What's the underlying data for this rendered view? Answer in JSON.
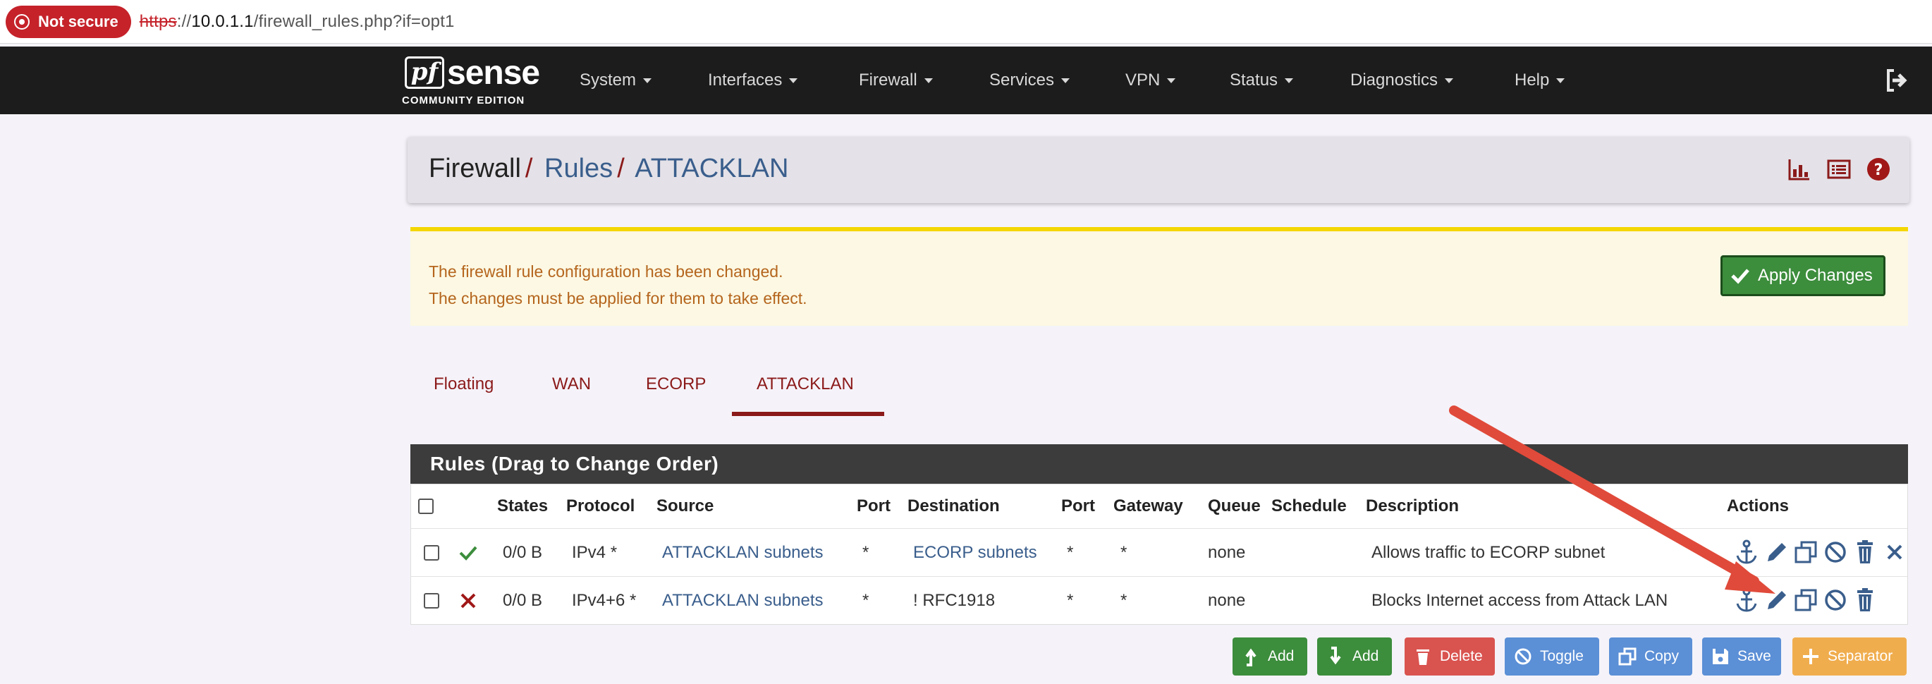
{
  "browser": {
    "security_label": "Not secure",
    "url_protocol": "https",
    "url_host": "10.0.1.1",
    "url_path": "/firewall_rules.php?if=opt1"
  },
  "brand": {
    "logo_pf": "pf",
    "logo_sense": "sense",
    "logo_subtitle": "COMMUNITY EDITION"
  },
  "nav": {
    "items": [
      "System",
      "Interfaces",
      "Firewall",
      "Services",
      "VPN",
      "Status",
      "Diagnostics",
      "Help"
    ]
  },
  "breadcrumb": {
    "root": "Firewall",
    "sep": "/",
    "level1": "Rules",
    "level2": "ATTACKLAN"
  },
  "alert": {
    "line1": "The firewall rule configuration has been changed.",
    "line2": "The changes must be applied for them to take effect.",
    "apply_label": "Apply Changes"
  },
  "tabs": {
    "items": [
      "Floating",
      "WAN",
      "ECORP",
      "ATTACKLAN"
    ],
    "active": "ATTACKLAN"
  },
  "rules": {
    "title": "Rules (Drag to Change Order)",
    "columns": [
      "States",
      "Protocol",
      "Source",
      "Port",
      "Destination",
      "Port",
      "Gateway",
      "Queue",
      "Schedule",
      "Description",
      "Actions"
    ],
    "rows": [
      {
        "status": "pass",
        "states": "0/0 B",
        "protocol": "IPv4 *",
        "source": "ATTACKLAN subnets",
        "source_port": "*",
        "destination": "ECORP subnets",
        "dest_port": "*",
        "gateway": "*",
        "queue": "none",
        "schedule": "",
        "description": "Allows traffic to ECORP subnet"
      },
      {
        "status": "block",
        "states": "0/0 B",
        "protocol": "IPv4+6 *",
        "source": "ATTACKLAN subnets",
        "source_port": "*",
        "destination": "! RFC1918",
        "dest_port": "*",
        "gateway": "*",
        "queue": "none",
        "schedule": "",
        "description": "Blocks Internet access from Attack LAN"
      }
    ]
  },
  "buttons": {
    "add_top": "Add",
    "add_bottom": "Add",
    "delete": "Delete",
    "toggle": "Toggle",
    "copy": "Copy",
    "save": "Save",
    "separator": "Separator"
  },
  "colors": {
    "navbar": "#1c1c1c",
    "accent_red": "#8b1a1a",
    "link_blue": "#3a5e8c",
    "success_green": "#3c8d3c",
    "alert_yellow": "#fcf8e3",
    "annotation_arrow": "#e04a3a"
  }
}
